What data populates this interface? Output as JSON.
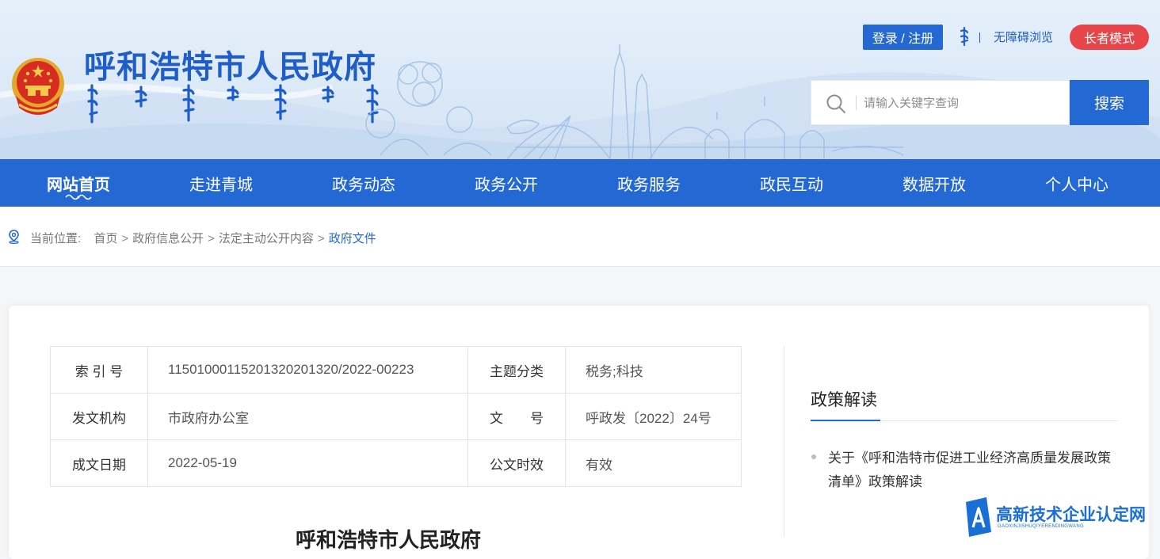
{
  "header": {
    "site_title": "呼和浩特市人民政府",
    "login_label": "登录 / 注册",
    "accessibility_label": "无障碍浏览",
    "elder_mode_label": "长者模式",
    "search_placeholder": "请输入关键字查询",
    "search_button": "搜索"
  },
  "nav": {
    "items": [
      {
        "label": "网站首页"
      },
      {
        "label": "走进青城"
      },
      {
        "label": "政务动态"
      },
      {
        "label": "政务公开"
      },
      {
        "label": "政务服务"
      },
      {
        "label": "政民互动"
      },
      {
        "label": "数据开放"
      },
      {
        "label": "个人中心"
      }
    ]
  },
  "breadcrumb": {
    "prefix": "当前位置:",
    "items": [
      "首页",
      "政府信息公开",
      "法定主动公开内容",
      "政府文件"
    ]
  },
  "info_table": {
    "rows": [
      {
        "label1": "索 引 号",
        "value1": "115010001152013202013​20/2022-00223",
        "label2": "主题分类",
        "value2": "税务;科技"
      },
      {
        "label1": "发文机构",
        "value1": "市政府办公室",
        "label2": "文　　号",
        "value2": "呼政发〔2022〕24号"
      },
      {
        "label1": "成文日期",
        "value1": "2022-05-19",
        "label2": "公文时效",
        "value2": "有效"
      }
    ]
  },
  "document": {
    "title_partial": "呼和浩特市人民政府"
  },
  "sidebar": {
    "title": "政策解读",
    "items": [
      {
        "text": "关于《呼和浩特市促进工业经济高质量发展政策清单》政策解读"
      }
    ]
  },
  "watermark": {
    "text": "高新技术企业认定网",
    "sub": "GAOXINJISHUQIYERENDINGWANG"
  },
  "colors": {
    "primary": "#2468d4",
    "elder_red": "#e8454a",
    "title_blue": "#1f5ec9"
  },
  "icons": {
    "emblem": "national-emblem-icon",
    "search": "search-icon",
    "location": "location-pin-icon",
    "mongol": "mongolian-script-icon"
  }
}
